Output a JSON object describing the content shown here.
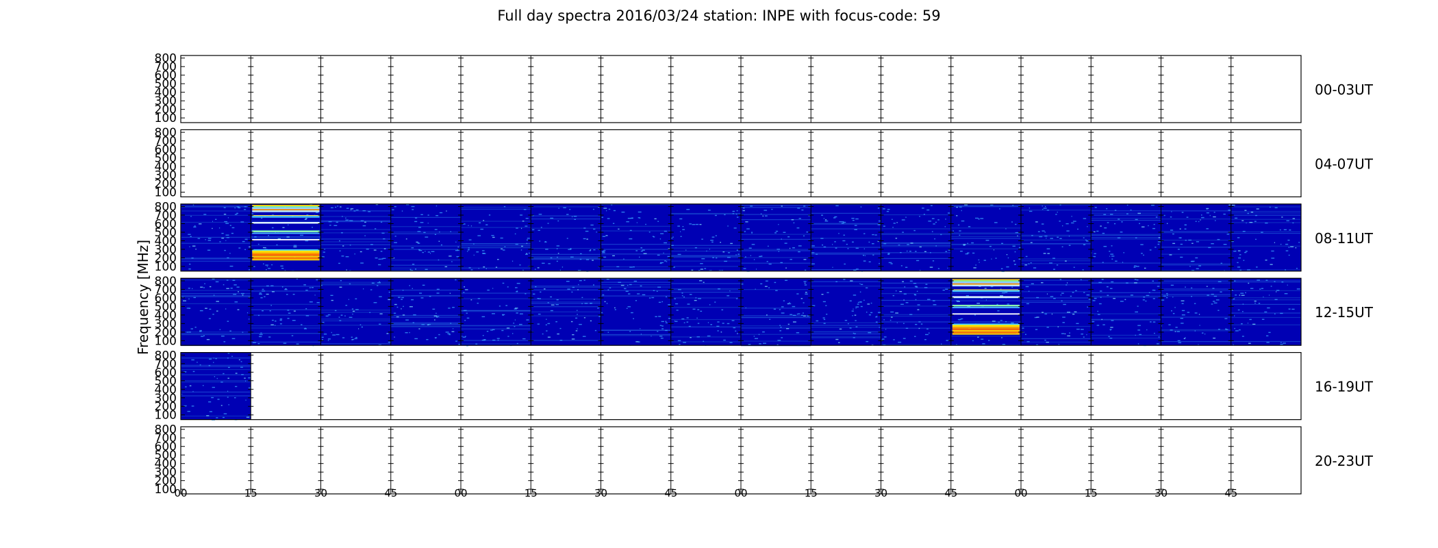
{
  "chart_data": {
    "type": "heatmap",
    "title": "Full day spectra 2016/03/24 station: INPE with focus-code: 59",
    "ylabel": "Frequency [MHz]",
    "xlabel": "",
    "ylim": [
      45,
      830
    ],
    "yticks": [
      "100",
      "200",
      "300",
      "400",
      "500",
      "600",
      "700",
      "800"
    ],
    "xtick_labels": [
      "00",
      "15",
      "30",
      "45",
      "00",
      "15",
      "30",
      "45",
      "00",
      "15",
      "30",
      "45",
      "00",
      "15",
      "30",
      "45"
    ],
    "row_labels": [
      "00-03UT",
      "04-07UT",
      "08-11UT",
      "12-15UT",
      "16-19UT",
      "20-23UT"
    ],
    "segments_per_row": 16,
    "segment_minutes": 15,
    "colormap": "jet",
    "colors": {
      "background": "#00008b",
      "base": "#0000b4",
      "speckle": "#3aa3ff",
      "burst_band": "#ffd200",
      "hot": "#ff6a00"
    },
    "data_coverage": [
      {
        "row": "00-03UT",
        "segments_with_data": []
      },
      {
        "row": "04-07UT",
        "segments_with_data": []
      },
      {
        "row": "08-11UT",
        "segments_with_data": [
          0,
          1,
          2,
          3,
          4,
          5,
          6,
          7,
          8,
          9,
          10,
          11,
          12,
          13,
          14,
          15
        ]
      },
      {
        "row": "12-15UT",
        "segments_with_data": [
          0,
          1,
          2,
          3,
          4,
          5,
          6,
          7,
          8,
          9,
          10,
          11,
          12,
          13,
          14,
          15
        ]
      },
      {
        "row": "16-19UT",
        "segments_with_data": [
          0
        ]
      },
      {
        "row": "20-23UT",
        "segments_with_data": []
      }
    ],
    "events": [
      {
        "row": "08-11UT",
        "segment": 1,
        "time_UT": "08:15-08:30",
        "freq_MHz": [
          170,
          820
        ],
        "description": "strong broadband burst"
      },
      {
        "row": "12-15UT",
        "segment": 11,
        "time_UT": "14:45-15:00",
        "freq_MHz": [
          170,
          820
        ],
        "description": "strong broadband burst"
      }
    ]
  }
}
